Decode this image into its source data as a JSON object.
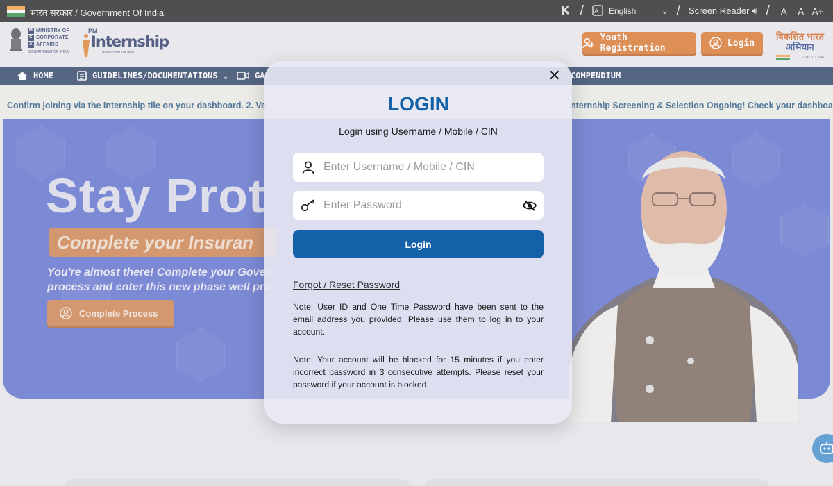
{
  "gov_bar": {
    "text": "भारत सरकार / Government Of India",
    "language": "English",
    "screen_reader": "Screen Reader",
    "text_size": [
      "A-",
      "A",
      "A+"
    ]
  },
  "header": {
    "mca": {
      "lines": [
        {
          "letter": "M",
          "text": "MINISTRY OF"
        },
        {
          "letter": "C",
          "text": "CORPORATE"
        },
        {
          "letter": "A",
          "text": "AFFAIRS"
        }
      ],
      "sub": "GOVERNMENT OF INDIA"
    },
    "pm_logo": {
      "small": "PM",
      "big": "Internship",
      "tag": "LEARN FROM THE BEST"
    },
    "youth_registration": "Youth Registration",
    "login": "Login",
    "viksit": {
      "line1": "विकसित भारत",
      "line2": "अभियान",
      "years": "1947 TO 2047"
    }
  },
  "nav": {
    "home": "HOME",
    "guidelines": "GUIDELINES/DOCUMENTATIONS",
    "gallery": "GAL",
    "compendium": "COMPENDIUM"
  },
  "ticker": {
    "left": "Confirm joining via the Internship tile on your dashboard. 2. Ve",
    "right": "nternship Screening & Selection Ongoing! Check your dashboa"
  },
  "hero": {
    "title": "Stay Prot",
    "pill": "Complete your Insuran",
    "desc_line1": "You're almost there! Complete your Gover",
    "desc_line2": "process and enter this new phase well pro",
    "button": "Complete Process"
  },
  "modal": {
    "title": "LOGIN",
    "subtitle": "Login using Username / Mobile / CIN",
    "username_placeholder": "Enter Username / Mobile / CIN",
    "password_placeholder": "Enter Password",
    "login_button": "Login",
    "forgot": "Forgot / Reset Password",
    "note1": "Note: User ID and One Time Password have been sent to the email address you provided. Please use them to log in to your account.",
    "note2": "Note: Your account will be blocked for 15 minutes if you enter incorrect password in 3 consecutive attempts. Please reset your password if your account is blocked."
  },
  "colors": {
    "accent_blue": "#1561a8",
    "orange": "#d96d19",
    "nav_bg": "#1d3358",
    "hero_bg": "#5264c9"
  },
  "icons": {
    "user": "user-icon",
    "key": "key-icon",
    "eye": "eye-slash-icon",
    "close": "close-icon",
    "home": "home-icon",
    "chat": "chatbot-icon"
  }
}
